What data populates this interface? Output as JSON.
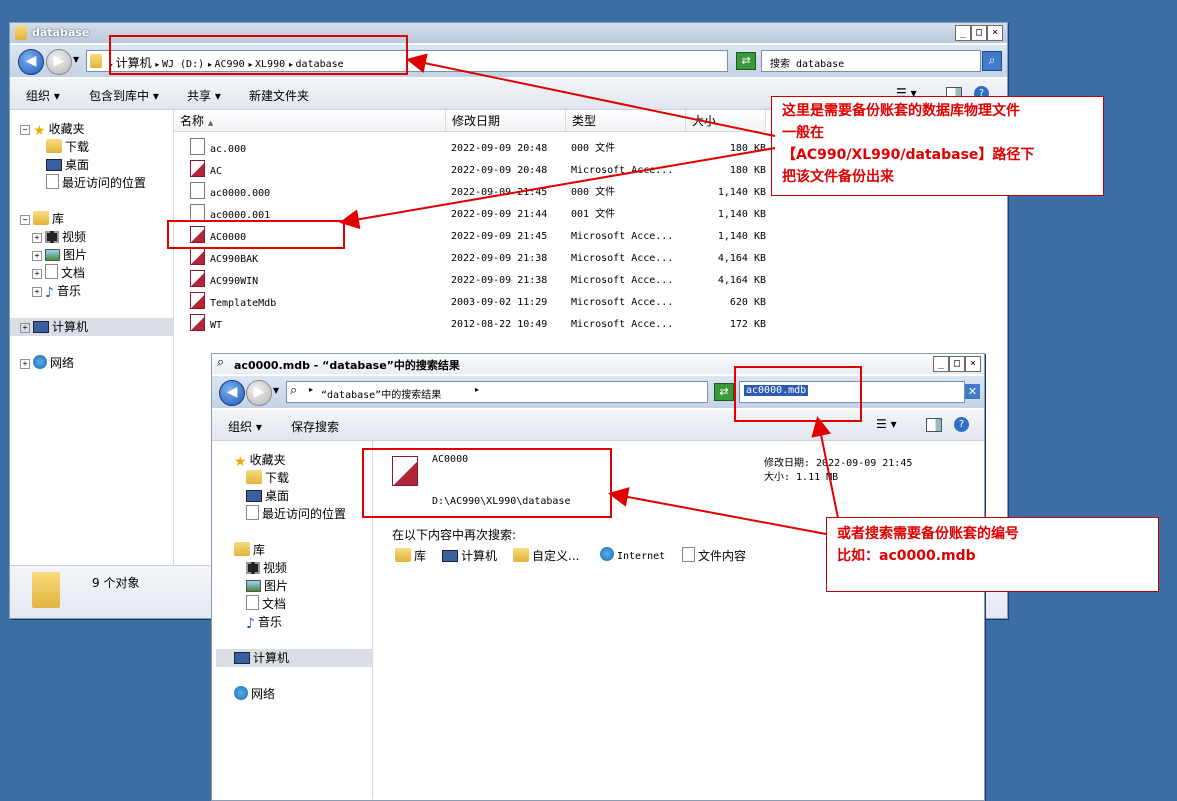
{
  "window1": {
    "title": "database",
    "controls": {
      "min": "_",
      "max": "□",
      "close": "×"
    },
    "breadcrumb": [
      {
        "label": "计算机",
        "sep": "▸"
      },
      {
        "label": "WJ (D:)",
        "sep": "▸"
      },
      {
        "label": "AC990",
        "sep": "▸"
      },
      {
        "label": "XL990",
        "sep": "▸"
      },
      {
        "label": "database",
        "sep": ""
      }
    ],
    "search_placeholder": "搜索 database",
    "toolbar": {
      "organize": "组织 ▾",
      "include": "包含到库中 ▾",
      "share": "共享 ▾",
      "new_folder": "新建文件夹"
    },
    "nav": {
      "favorites": "收藏夹",
      "downloads": "下载",
      "desktop": "桌面",
      "recent": "最近访问的位置",
      "libraries": "库",
      "videos": "视频",
      "pictures": "图片",
      "documents": "文档",
      "music": "音乐",
      "computer": "计算机",
      "network": "网络"
    },
    "columns": {
      "name": "名称",
      "date": "修改日期",
      "type": "类型",
      "size": "大小"
    },
    "files": [
      {
        "name": "ac.000",
        "date": "2022-09-09 20:48",
        "type": "000 文件",
        "size": "180 KB"
      },
      {
        "name": "AC",
        "date": "2022-09-09 20:48",
        "type": "Microsoft Acce...",
        "size": "180 KB"
      },
      {
        "name": "ac0000.000",
        "date": "2022-09-09 21:45",
        "type": "000 文件",
        "size": "1,140 KB"
      },
      {
        "name": "ac0000.001",
        "date": "2022-09-09 21:44",
        "type": "001 文件",
        "size": "1,140 KB"
      },
      {
        "name": "AC0000",
        "date": "2022-09-09 21:45",
        "type": "Microsoft Acce...",
        "size": "1,140 KB"
      },
      {
        "name": "AC990BAK",
        "date": "2022-09-09 21:38",
        "type": "Microsoft Acce...",
        "size": "4,164 KB"
      },
      {
        "name": "AC990WIN",
        "date": "2022-09-09 21:38",
        "type": "Microsoft Acce...",
        "size": "4,164 KB"
      },
      {
        "name": "TemplateMdb",
        "date": "2003-09-02 11:29",
        "type": "Microsoft Acce...",
        "size": "620 KB"
      },
      {
        "name": "WT",
        "date": "2012-08-22 10:49",
        "type": "Microsoft Acce...",
        "size": "172 KB"
      }
    ],
    "status": "9 个对象"
  },
  "window2": {
    "title": "ac0000.mdb - “database”中的搜索结果",
    "breadcrumb": "“database”中的搜索结果",
    "search_value": "ac0000.mdb",
    "toolbar": {
      "organize": "组织 ▾",
      "save_search": "保存搜索"
    },
    "nav": {
      "favorites": "收藏夹",
      "downloads": "下载",
      "desktop": "桌面",
      "recent": "最近访问的位置",
      "libraries": "库",
      "videos": "视频",
      "pictures": "图片",
      "documents": "文档",
      "music": "音乐",
      "computer": "计算机",
      "network": "网络"
    },
    "result": {
      "name": "AC0000",
      "path": "D:\\AC990\\XL990\\database",
      "date_label": "修改日期: 2022-09-09 21:45",
      "size_label": "大小: 1.11 MB"
    },
    "search_again_label": "在以下内容中再次搜索:",
    "search_again": [
      "库",
      "计算机",
      "自定义...",
      "Internet",
      "文件内容"
    ]
  },
  "annotations": {
    "note1": [
      "这里是需要备份账套的数据库物理文件",
      "一般在",
      "【AC990/XL990/database】路径下",
      "把该文件备份出来"
    ],
    "note2": [
      "或者搜索需要备份账套的编号",
      "比如：ac0000.mdb"
    ],
    "color": "#e00000"
  }
}
